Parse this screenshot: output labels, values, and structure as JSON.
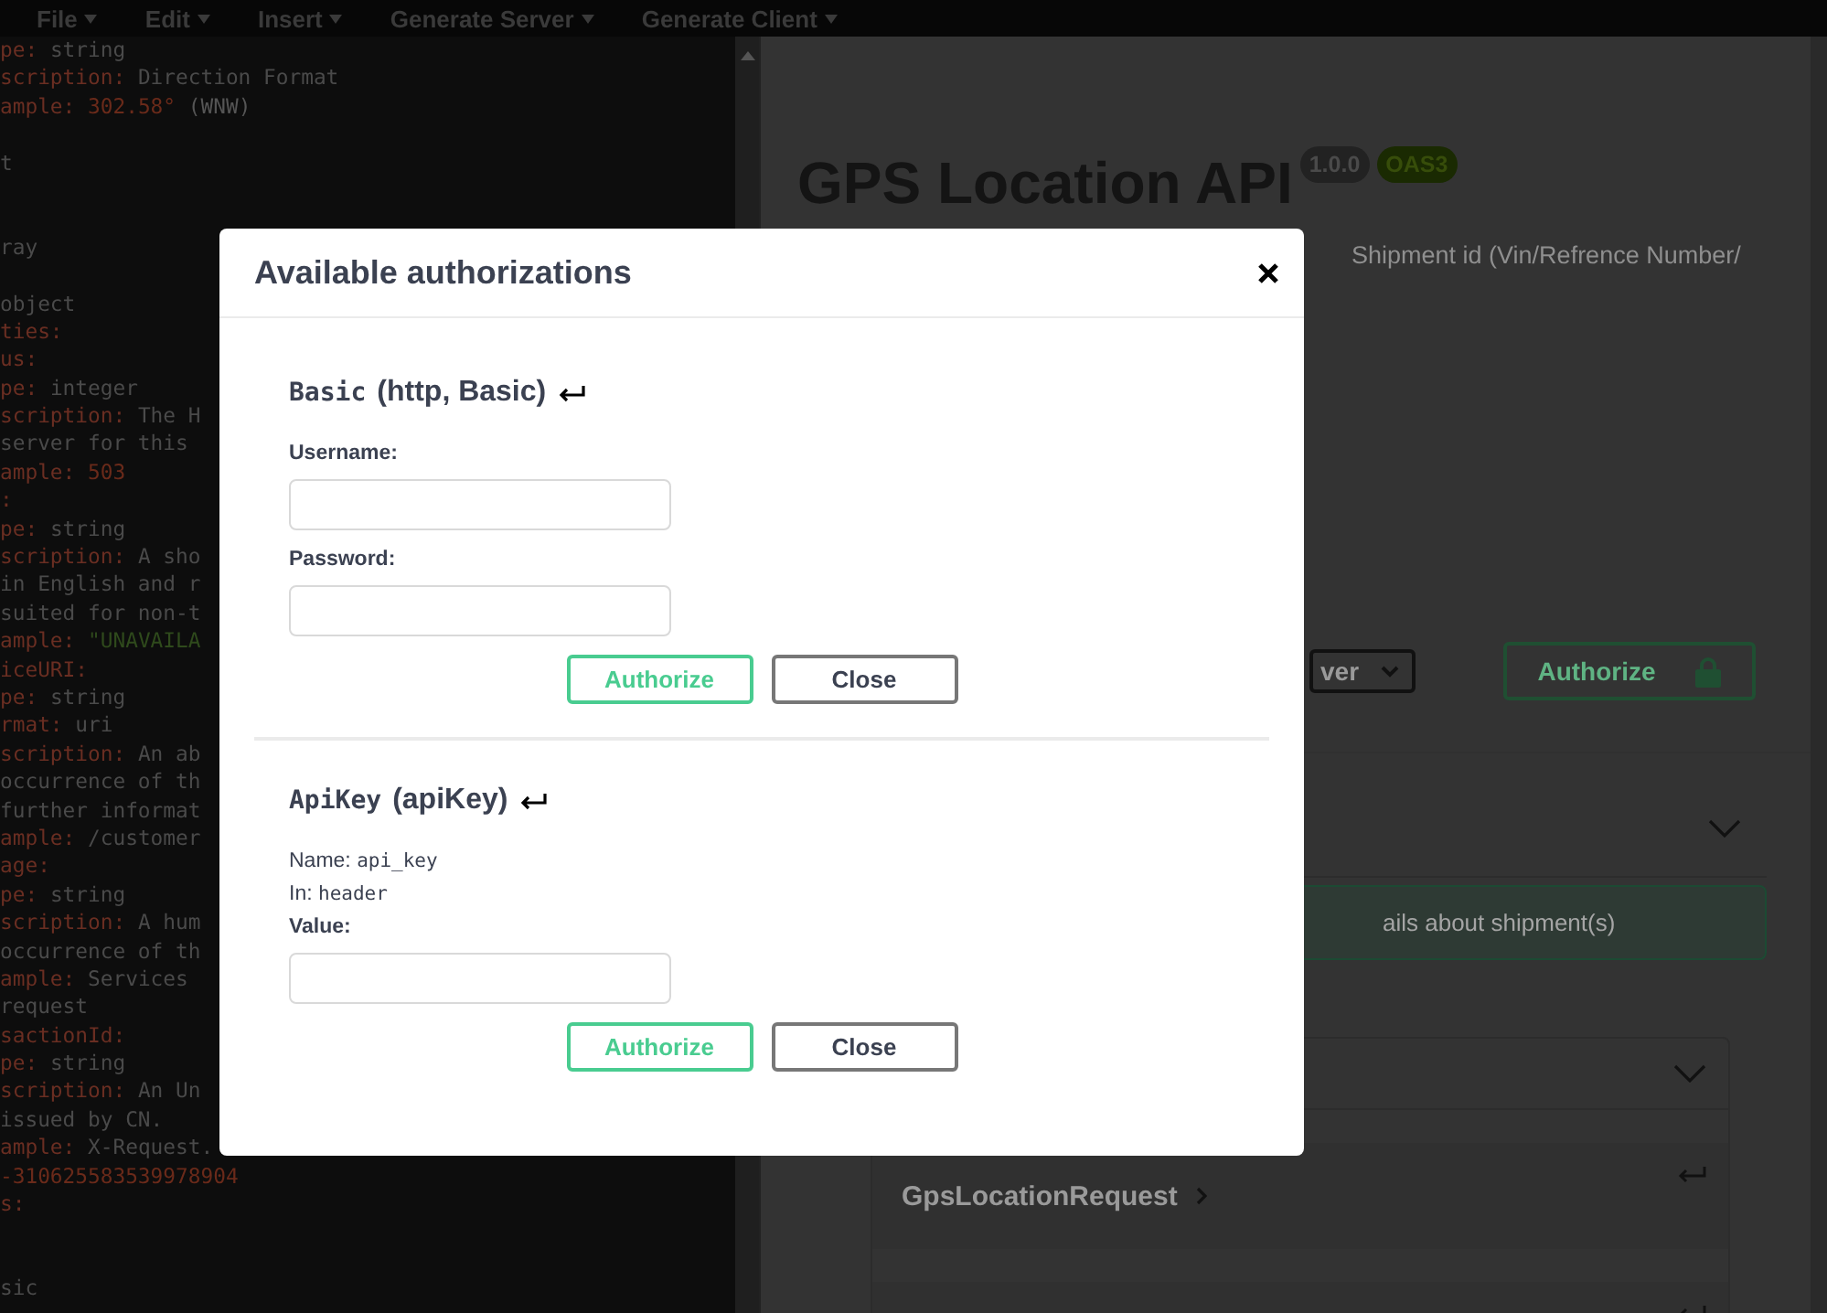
{
  "menu": [
    {
      "label": "File"
    },
    {
      "label": "Edit"
    },
    {
      "label": "Insert"
    },
    {
      "label": "Generate Server"
    },
    {
      "label": "Generate Client"
    }
  ],
  "editor": {
    "lines": [
      {
        "kind": "text",
        "key": "pe:",
        "value": "string"
      },
      {
        "kind": "text",
        "key": "scription:",
        "value": "Direction Format"
      },
      {
        "kind": "number",
        "key": "ample:",
        "value": "302.58°",
        "extra": "(WNW)"
      },
      {
        "kind": "blank"
      },
      {
        "kind": "text",
        "value": "t"
      },
      {
        "kind": "blank"
      },
      {
        "kind": "blank"
      },
      {
        "kind": "text",
        "value": "ray"
      },
      {
        "kind": "blank"
      },
      {
        "kind": "text",
        "value": "object"
      },
      {
        "kind": "text",
        "key": "ties:"
      },
      {
        "kind": "text",
        "key": "us:"
      },
      {
        "kind": "text",
        "key": "pe:",
        "value": "integer"
      },
      {
        "kind": "text",
        "key": "scription:",
        "value": "The H"
      },
      {
        "kind": "text",
        "value": "server for this"
      },
      {
        "kind": "number",
        "key": "ample:",
        "value": "503"
      },
      {
        "kind": "text",
        "key": ":"
      },
      {
        "kind": "text",
        "key": "pe:",
        "value": "string"
      },
      {
        "kind": "text",
        "key": "scription:",
        "value": "A sho"
      },
      {
        "kind": "text",
        "value": "in English and r"
      },
      {
        "kind": "text",
        "value": "suited for non-t"
      },
      {
        "kind": "string",
        "key": "ample:",
        "value": "\"UNAVAILA"
      },
      {
        "kind": "text",
        "key": "iceURI:"
      },
      {
        "kind": "text",
        "key": "pe:",
        "value": "string"
      },
      {
        "kind": "text",
        "key": "rmat:",
        "value": "uri"
      },
      {
        "kind": "text",
        "key": "scription:",
        "value": "An ab"
      },
      {
        "kind": "text",
        "value": "occurrence of th"
      },
      {
        "kind": "text",
        "value": "further informat"
      },
      {
        "kind": "text",
        "key": "ample:",
        "value": "/customer"
      },
      {
        "kind": "text",
        "key": "age:"
      },
      {
        "kind": "text",
        "key": "pe:",
        "value": "string"
      },
      {
        "kind": "text",
        "key": "scription:",
        "value": "A hum"
      },
      {
        "kind": "text",
        "value": "occurrence of th"
      },
      {
        "kind": "text",
        "key": "ample:",
        "value": "Services"
      },
      {
        "kind": "text",
        "value": "request"
      },
      {
        "kind": "text",
        "key": "sactionId:"
      },
      {
        "kind": "text",
        "key": "pe:",
        "value": "string"
      },
      {
        "kind": "text",
        "key": "scription:",
        "value": "An Un"
      },
      {
        "kind": "text",
        "value": "issued by CN."
      },
      {
        "kind": "text",
        "key": "ample:",
        "value": "X-Request."
      },
      {
        "kind": "number",
        "value": "-310625583539978904"
      },
      {
        "kind": "text",
        "key": "s:"
      },
      {
        "kind": "blank"
      },
      {
        "kind": "blank"
      },
      {
        "kind": "text",
        "value": "sic"
      }
    ]
  },
  "api_info": {
    "title": "GPS Location API",
    "version": "1.0.0",
    "spec": "OAS3",
    "description": "Shipment id (Vin/Refrence Number/"
  },
  "servers_select": {
    "value": "ver"
  },
  "authorize_button": {
    "label": "Authorize",
    "locked": true
  },
  "operations_section": {
    "expanded": true,
    "operation_summary": "ails about shipment(s)"
  },
  "schemas_section": {
    "expanded": true,
    "models": [
      {
        "kind": "named",
        "name": "GpsLocationRequest"
      },
      {
        "kind": "hidden"
      }
    ]
  },
  "modal": {
    "title": "Available authorizations",
    "schemes": [
      {
        "name": "Basic",
        "type": "(http, Basic)",
        "fields": [
          {
            "label": "Username:"
          },
          {
            "label": "Password:"
          }
        ],
        "buttons": [
          {
            "kind": "primary",
            "label": "Authorize"
          },
          {
            "kind": "secondary",
            "label": "Close"
          }
        ]
      },
      {
        "name": "ApiKey",
        "type": "(apiKey)",
        "details": [
          {
            "label": "Name:",
            "value": "api_key"
          },
          {
            "label": "In:",
            "value": "header"
          }
        ],
        "fields": [
          {
            "label": "Value:"
          }
        ],
        "buttons": [
          {
            "kind": "primary",
            "label": "Authorize"
          },
          {
            "kind": "secondary",
            "label": "Close"
          }
        ]
      }
    ]
  }
}
